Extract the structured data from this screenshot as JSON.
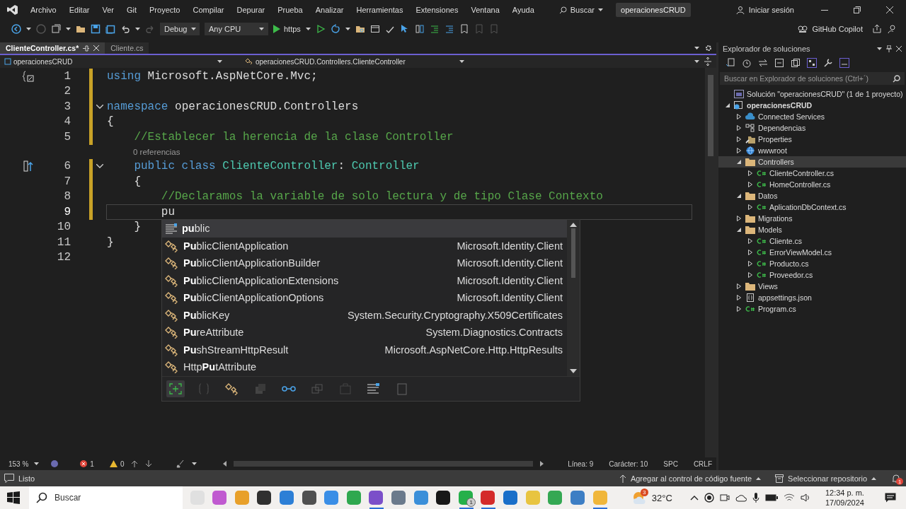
{
  "title_bar": {
    "menu": [
      "Archivo",
      "Editar",
      "Ver",
      "Git",
      "Proyecto",
      "Compilar",
      "Depurar",
      "Prueba",
      "Analizar",
      "Herramientas",
      "Extensiones",
      "Ventana",
      "Ayuda"
    ],
    "search": "Buscar",
    "solution_name": "operacionesCRUD",
    "sign_in": "Iniciar sesión"
  },
  "toolbar": {
    "configuration": "Debug",
    "platform": "Any CPU",
    "run_target": "https",
    "copilot": "GitHub Copilot"
  },
  "editor": {
    "tabs": [
      {
        "label": "ClienteController.cs*",
        "selected": true
      },
      {
        "label": "Cliente.cs",
        "selected": false
      }
    ],
    "nav": {
      "project": "operacionesCRUD",
      "type": "operacionesCRUD.Controllers.ClienteController"
    },
    "lines": [
      {
        "kind": "code",
        "number": "1",
        "quick_actions": true,
        "inheritance": false,
        "modified": true,
        "fold": false,
        "current": false,
        "tokens": [
          {
            "kind": "keyword",
            "text": "using"
          },
          {
            "kind": "plain",
            "text": " Microsoft.AspNetCore.Mvc;"
          }
        ]
      },
      {
        "kind": "code",
        "number": "2",
        "modified": true,
        "fold": false,
        "current": false
      },
      {
        "kind": "code",
        "number": "3",
        "modified": true,
        "fold": true,
        "current": false,
        "tokens": [
          {
            "kind": "keyword",
            "text": "namespace"
          },
          {
            "kind": "plain",
            "text": " operacionesCRUD.Controllers"
          }
        ]
      },
      {
        "kind": "code",
        "number": "4",
        "modified": true,
        "fold": false,
        "current": false,
        "tokens": [
          {
            "kind": "plain",
            "text": "{"
          }
        ]
      },
      {
        "kind": "code",
        "number": "5",
        "modified": true,
        "fold": false,
        "current": false,
        "tokens": [
          {
            "kind": "comment",
            "text": "    //Establecer la herencia de la clase Controller"
          }
        ]
      },
      {
        "kind": "lens",
        "text": "0 referencias"
      },
      {
        "kind": "code",
        "number": "6",
        "quick_actions": false,
        "inheritance": true,
        "modified": true,
        "fold": true,
        "current": false,
        "tokens": [
          {
            "kind": "keyword",
            "text": "    public class "
          },
          {
            "kind": "type",
            "text": "ClienteController"
          },
          {
            "kind": "plain",
            "text": ": "
          },
          {
            "kind": "type",
            "text": "Controller"
          }
        ]
      },
      {
        "kind": "code",
        "number": "7",
        "modified": true,
        "fold": false,
        "current": false,
        "tokens": [
          {
            "kind": "plain",
            "text": "    {"
          }
        ]
      },
      {
        "kind": "code",
        "number": "8",
        "modified": true,
        "fold": false,
        "current": false,
        "tokens": [
          {
            "kind": "comment",
            "text": "        //Declaramos la variable de solo lectura y de tipo Clase Contexto"
          }
        ]
      },
      {
        "kind": "code",
        "number": "9",
        "modified": true,
        "fold": false,
        "current": true,
        "tokens": [
          {
            "kind": "plain",
            "text": "        pu"
          }
        ]
      },
      {
        "kind": "code",
        "number": "10",
        "modified": false,
        "fold": false,
        "current": false,
        "tokens": [
          {
            "kind": "plain",
            "text": "    }"
          }
        ]
      },
      {
        "kind": "code",
        "number": "11",
        "modified": false,
        "fold": false,
        "current": false,
        "tokens": [
          {
            "kind": "plain",
            "text": "}"
          }
        ]
      },
      {
        "kind": "code",
        "number": "12",
        "modified": false,
        "fold": false,
        "current": false
      }
    ],
    "completion": {
      "items": [
        {
          "label": "**pu**blic",
          "kind": "keyword",
          "selected": true
        },
        {
          "label": "**Pu**blicClientApplication",
          "namespace": "Microsoft.Identity.Client",
          "kind": "class",
          "selected": false
        },
        {
          "label": "**Pu**blicClientApplicationBuilder",
          "namespace": "Microsoft.Identity.Client",
          "kind": "class",
          "selected": false
        },
        {
          "label": "**Pu**blicClientApplicationExtensions",
          "namespace": "Microsoft.Identity.Client",
          "kind": "class",
          "selected": false
        },
        {
          "label": "**Pu**blicClientApplicationOptions",
          "namespace": "Microsoft.Identity.Client",
          "kind": "class",
          "selected": false
        },
        {
          "label": "**Pu**blicKey",
          "namespace": "System.Security.Cryptography.X509Certificates",
          "kind": "class",
          "selected": false
        },
        {
          "label": "**Pu**reAttribute",
          "namespace": "System.Diagnostics.Contracts",
          "kind": "class",
          "selected": false
        },
        {
          "label": "**Pu**shStreamHttpResult",
          "namespace": "Microsoft.AspNetCore.Http.HttpResults",
          "kind": "class",
          "selected": false
        },
        {
          "label": "Http**Pu**tAttribute",
          "kind": "class",
          "selected": false
        }
      ]
    },
    "status": {
      "zoom": "153 %",
      "errors": "1",
      "warnings": "0",
      "line": "Línea: 9",
      "column": "Carácter: 10",
      "whitespace": "SPC",
      "line_ending": "CRLF"
    }
  },
  "solution_explorer": {
    "title": "Explorador de soluciones",
    "search_placeholder": "Buscar en Explorador de soluciones (Ctrl+´)",
    "tree": [
      {
        "label": "Solución \"operacionesCRUD\"  (1 de 1 proyecto)",
        "kind": "solution",
        "selected": false
      },
      {
        "label": "operacionesCRUD",
        "kind": "project",
        "expanded": true,
        "selected": false,
        "children": [
          {
            "label": "Connected Services",
            "kind": "service",
            "expanded": false,
            "selected": false
          },
          {
            "label": "Dependencias",
            "kind": "dependencies",
            "expanded": false,
            "selected": false
          },
          {
            "label": "Properties",
            "kind": "properties",
            "expanded": false,
            "selected": false
          },
          {
            "label": "wwwroot",
            "kind": "web",
            "expanded": false,
            "selected": false
          },
          {
            "label": "Controllers",
            "kind": "folder",
            "expanded": true,
            "selected": true,
            "children": [
              {
                "label": "ClienteController.cs",
                "kind": "csharp",
                "expanded": false,
                "selected": false
              },
              {
                "label": "HomeController.cs",
                "kind": "csharp",
                "expanded": false,
                "selected": false
              }
            ]
          },
          {
            "label": "Datos",
            "kind": "folder",
            "expanded": true,
            "selected": false,
            "children": [
              {
                "label": "AplicationDbContext.cs",
                "kind": "csharp",
                "expanded": false,
                "selected": false
              }
            ]
          },
          {
            "label": "Migrations",
            "kind": "folder",
            "expanded": false,
            "selected": false
          },
          {
            "label": "Models",
            "kind": "folder",
            "expanded": true,
            "selected": false,
            "children": [
              {
                "label": "Cliente.cs",
                "kind": "csharp",
                "expanded": false,
                "selected": false
              },
              {
                "label": "ErrorViewModel.cs",
                "kind": "csharp",
                "expanded": false,
                "selected": false
              },
              {
                "label": "Producto.cs",
                "kind": "csharp",
                "expanded": false,
                "selected": false
              },
              {
                "label": "Proveedor.cs",
                "kind": "csharp",
                "expanded": false,
                "selected": false
              }
            ]
          },
          {
            "label": "Views",
            "kind": "folder",
            "expanded": false,
            "selected": false
          },
          {
            "label": "appsettings.json",
            "kind": "json",
            "expanded": false,
            "selected": false
          },
          {
            "label": "Program.cs",
            "kind": "csharp",
            "expanded": false,
            "selected": false
          }
        ]
      }
    ]
  },
  "status_bar": {
    "state": "Listo",
    "source_control": "Agregar al control de código fuente",
    "repository": "Seleccionar repositorio",
    "notifications": "1"
  },
  "taskbar": {
    "search": "Buscar",
    "apps": [
      {
        "color": "#e0e0e0",
        "running": false
      },
      {
        "color": "#c05ad0",
        "running": false
      },
      {
        "color": "#e8a02a",
        "running": false
      },
      {
        "color": "#303030",
        "running": false
      },
      {
        "color": "#2d7fd6",
        "running": false
      },
      {
        "color": "#505050",
        "running": false
      },
      {
        "color": "#3a8ee6",
        "running": false
      },
      {
        "color": "#2fa84f",
        "running": false
      },
      {
        "color": "#7b4fc9",
        "running": true
      },
      {
        "color": "#6b7a8c",
        "running": false
      },
      {
        "color": "#3b8fd9",
        "running": false
      },
      {
        "color": "#181818",
        "running": false
      },
      {
        "color": "#25b04a",
        "running": true,
        "badge": "1"
      },
      {
        "color": "#d42a2a",
        "running": true
      },
      {
        "color": "#1a6fc9",
        "running": false
      },
      {
        "color": "#e8c440",
        "running": false
      },
      {
        "color": "#34a853",
        "running": false
      },
      {
        "color": "#3d7ec4",
        "running": false
      },
      {
        "color": "#f0b63a",
        "running": true
      }
    ],
    "weather_alerts": "3",
    "weather": "32°C",
    "time": "12:34 p. m.",
    "date": "17/09/2024"
  }
}
